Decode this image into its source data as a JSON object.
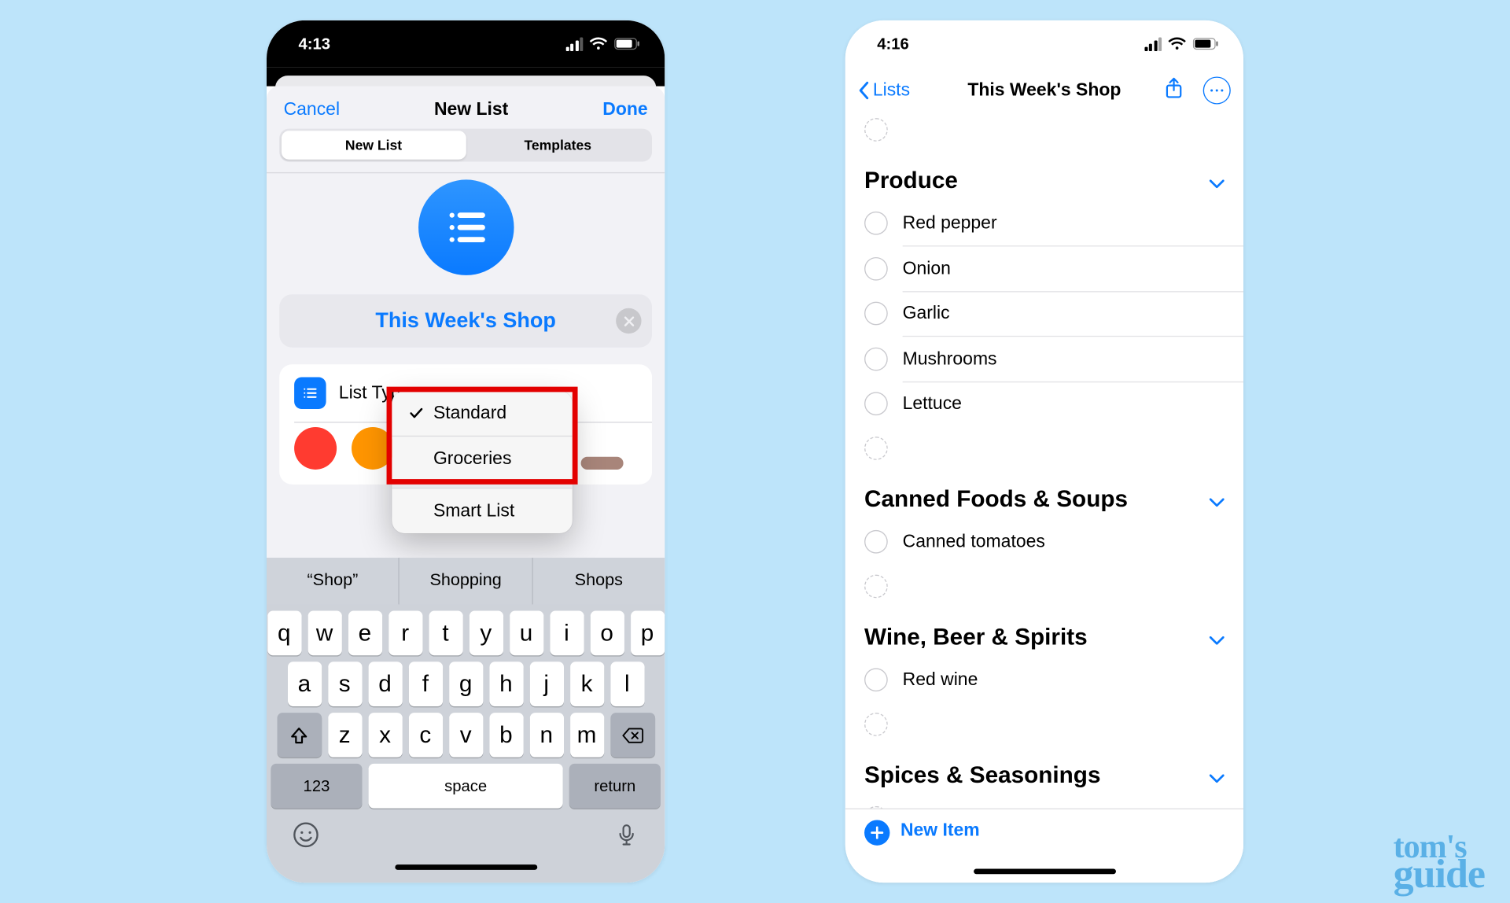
{
  "watermark": {
    "line1": "tom's",
    "line2": "guide"
  },
  "left": {
    "status": {
      "time": "4:13"
    },
    "modal": {
      "cancel": "Cancel",
      "title": "New List",
      "done": "Done",
      "seg": {
        "newlist": "New List",
        "templates": "Templates"
      },
      "list_name": "This Week's Shop",
      "listtype_label": "List Type",
      "popup": {
        "standard": "Standard",
        "groceries": "Groceries",
        "smartlist": "Smart List"
      },
      "colors": [
        "#ff3b30",
        "#ff9500",
        "#5856d6",
        "#d93a6a",
        "#8e8e93",
        "#a8857a"
      ]
    },
    "keyboard": {
      "predict": [
        "“Shop”",
        "Shopping",
        "Shops"
      ],
      "row1": [
        "q",
        "w",
        "e",
        "r",
        "t",
        "y",
        "u",
        "i",
        "o",
        "p"
      ],
      "row2": [
        "a",
        "s",
        "d",
        "f",
        "g",
        "h",
        "j",
        "k",
        "l"
      ],
      "row3": [
        "z",
        "x",
        "c",
        "v",
        "b",
        "n",
        "m"
      ],
      "numkey": "123",
      "space": "space",
      "return": "return"
    }
  },
  "right": {
    "status": {
      "time": "4:16"
    },
    "nav": {
      "back": "Lists",
      "title": "This Week's Shop"
    },
    "sections": [
      {
        "title": "Produce",
        "items": [
          "Red pepper",
          "Onion",
          "Garlic",
          "Mushrooms",
          "Lettuce"
        ]
      },
      {
        "title": "Canned Foods & Soups",
        "items": [
          "Canned tomatoes"
        ]
      },
      {
        "title": "Wine, Beer & Spirits",
        "items": [
          "Red wine"
        ]
      },
      {
        "title": "Spices & Seasonings",
        "items": []
      }
    ],
    "toolbar": {
      "newitem": "New Item"
    }
  }
}
